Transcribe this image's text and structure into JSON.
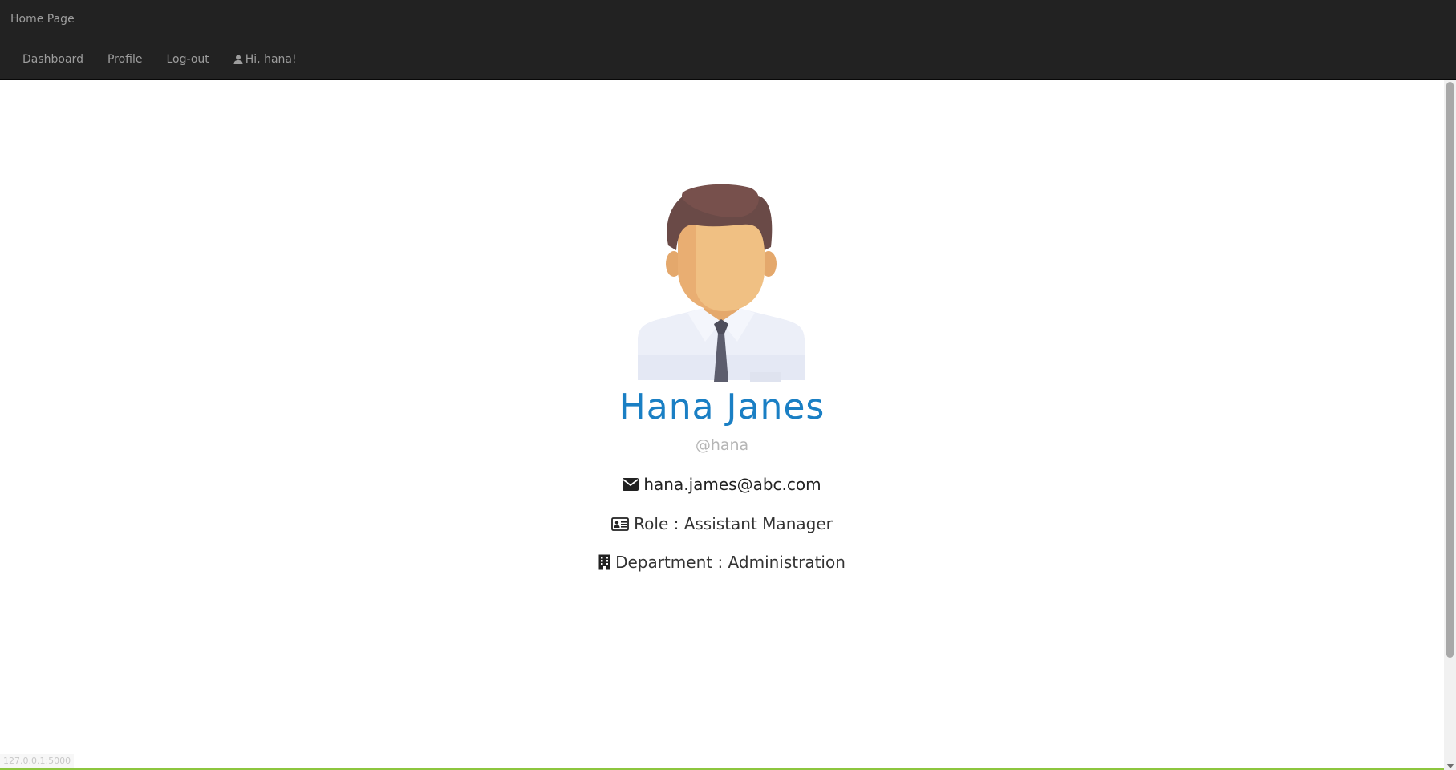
{
  "navbar": {
    "brand": "Home Page",
    "links": [
      {
        "label": "Dashboard"
      },
      {
        "label": "Profile"
      },
      {
        "label": "Log-out"
      },
      {
        "label": "Hi, hana!"
      }
    ]
  },
  "profile": {
    "name": "Hana Janes",
    "username": "@hana",
    "email": "hana.james@abc.com",
    "role": "Role : Assistant Manager",
    "department": "Department : Administration"
  },
  "status": {
    "url": "127.0.0.1:5000"
  },
  "colors": {
    "navbar_bg": "#222222",
    "nav_text": "#9d9d9d",
    "name_blue": "#1a7fc4",
    "username_gray": "#b5b5b5",
    "bottom_accent": "#8dc63f"
  },
  "icons": {
    "user": "user-icon",
    "email": "envelope-icon",
    "role": "id-card-icon",
    "department": "building-icon"
  }
}
